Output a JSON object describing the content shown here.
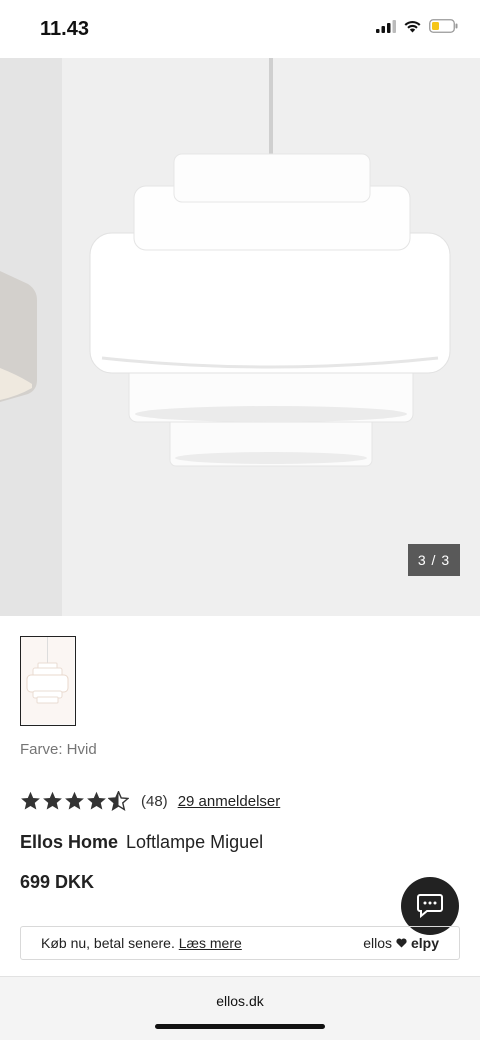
{
  "status_bar": {
    "time": "11.43",
    "signal_icon": "cellular-signal-icon",
    "wifi_icon": "wifi-icon",
    "battery_icon": "battery-low-icon",
    "battery_color": "#f5c518"
  },
  "gallery": {
    "counter": "3 / 3"
  },
  "product": {
    "color_label": "Farve: Hvid",
    "rating_value": 4.5,
    "rating_count": "(48)",
    "reviews_link": "29 anmeldelser",
    "brand": "Ellos Home",
    "name": "Loftlampe Miguel",
    "price": "699 DKK"
  },
  "paylater": {
    "text": "Køb nu, betal senere.",
    "link": "Læs mere",
    "partner_left": "ellos",
    "partner_right": "elpy",
    "heart_icon": "heart-icon"
  },
  "chat": {
    "icon": "chat-bubble-icon"
  },
  "browser": {
    "url": "ellos.dk"
  }
}
